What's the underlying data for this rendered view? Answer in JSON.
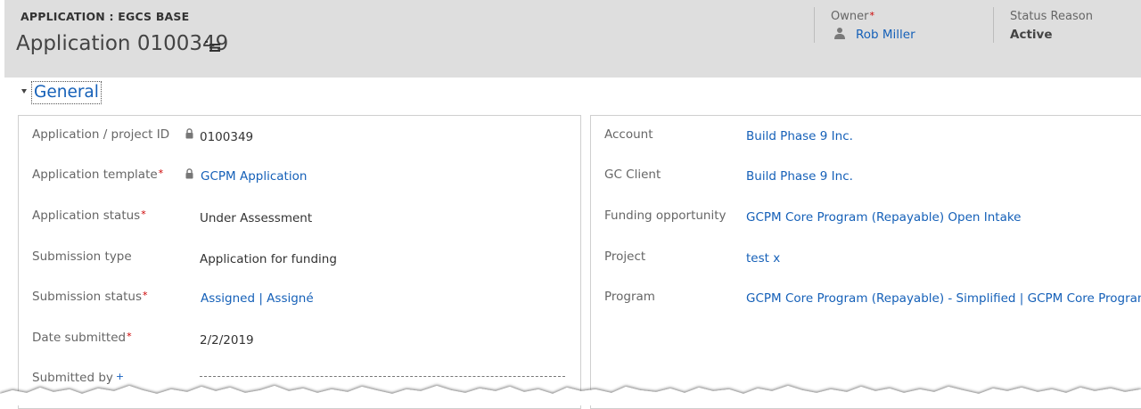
{
  "header": {
    "entity_type": "APPLICATION : EGCS BASE",
    "record_title": "Application 0100349",
    "owner": {
      "label": "Owner",
      "required_mark": "*",
      "value": "Rob Miller",
      "icon": "person-icon"
    },
    "status_reason": {
      "label": "Status Reason",
      "value": "Active"
    }
  },
  "section": {
    "title": "General",
    "toggle_icon": "collapse-triangle-icon"
  },
  "left_fields": [
    {
      "label": "Application / project ID",
      "required_mark": "",
      "value": "0100349",
      "locked": true
    },
    {
      "label": "Application template",
      "required_mark": "*",
      "value": "GCPM Application",
      "locked": true,
      "link": true
    },
    {
      "label": "Application status",
      "required_mark": "*",
      "value": "Under Assessment"
    },
    {
      "label": "Submission type",
      "required_mark": "",
      "value": "Application for funding"
    },
    {
      "label": "Submission status",
      "required_mark": "*",
      "value": "Assigned | Assigné",
      "link": true
    },
    {
      "label": "Date submitted",
      "required_mark": "*",
      "value": "2/2/2019"
    },
    {
      "label": "Submitted by",
      "required_mark": "+",
      "value": ""
    }
  ],
  "right_fields": [
    {
      "label": "Account",
      "value": "Build Phase 9 Inc.",
      "link": true
    },
    {
      "label": "GC Client",
      "value": "Build Phase 9 Inc.",
      "link": true
    },
    {
      "label": "Funding opportunity",
      "value": "GCPM Core Program (Repayable) Open Intake",
      "link": true
    },
    {
      "label": "Project",
      "value": "test x",
      "link": true
    },
    {
      "label": "Program",
      "value": "GCPM Core Program (Repayable) - Simplified | GCPM Core Program",
      "link": true
    }
  ],
  "colors": {
    "header_bg": "#dedede",
    "link": "#1560b8",
    "required": "#cc0000",
    "recommended": "#1560c0"
  }
}
